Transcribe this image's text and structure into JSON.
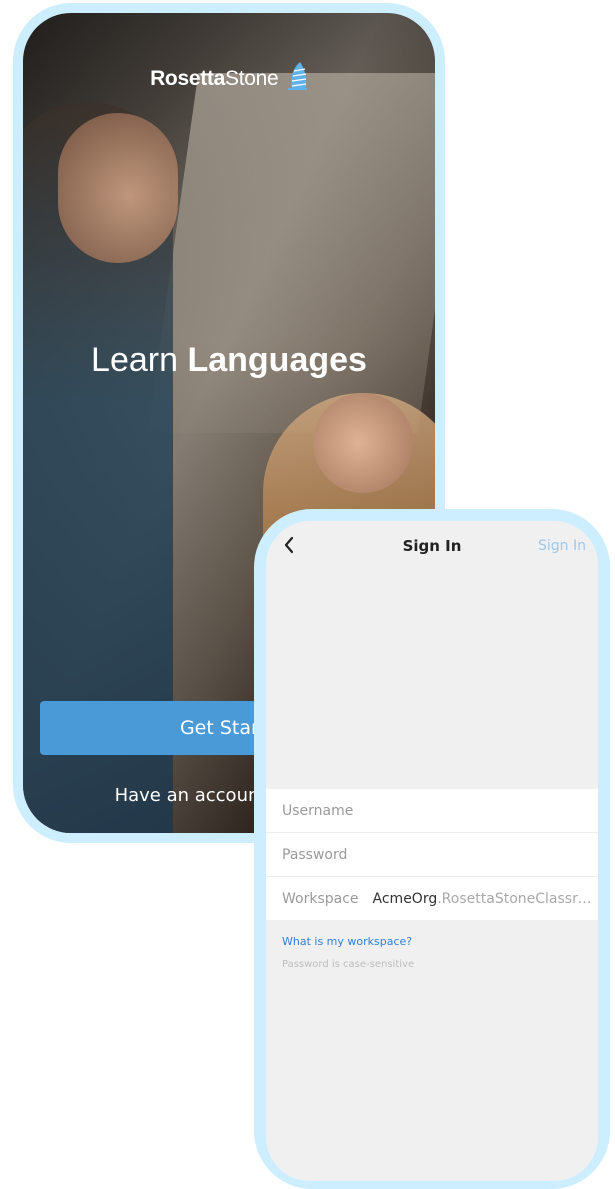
{
  "welcome": {
    "logo_bold": "Rosetta",
    "logo_light": "Stone",
    "logo_icon": "sail-icon",
    "hero_light": "Learn",
    "hero_bold": "Languages",
    "get_started_label": "Get Started",
    "have_account_label": "Have an account? Sign In",
    "button_color": "#4a9ad8"
  },
  "signin": {
    "back_icon": "chevron-left-icon",
    "title": "Sign In",
    "action_label": "Sign In",
    "username_placeholder": "Username",
    "password_placeholder": "Password",
    "workspace_label": "Workspace",
    "workspace_org": "AcmeOrg",
    "workspace_domain": ".RosettaStoneClassroom.com",
    "help_link": "What is my workspace?",
    "help_note": "Password is case-sensitive",
    "link_color": "#2f7fd6",
    "disabled_action_color": "#9cc8ec"
  },
  "frame_color": "#cdeeff"
}
